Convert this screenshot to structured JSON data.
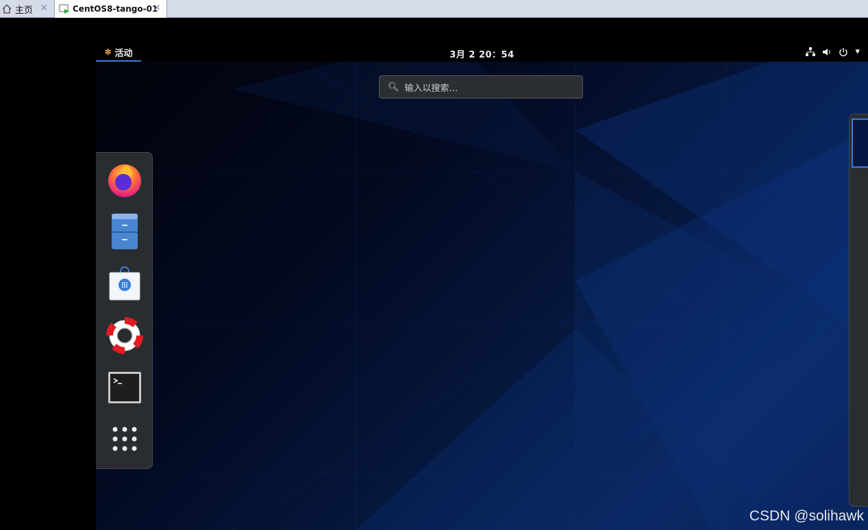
{
  "tabs": [
    {
      "label": "主页",
      "icon": "home-icon"
    },
    {
      "label": "CentOS8-tango-01",
      "icon": "vm-icon"
    }
  ],
  "topbar": {
    "activities_label": "活动",
    "clock": "3月 2  20：54",
    "tray_icons": [
      "network-icon",
      "volume-icon",
      "power-icon",
      "dropdown-icon"
    ]
  },
  "search": {
    "placeholder": "输入以搜索…"
  },
  "dash": {
    "apps": [
      "firefox-icon",
      "files-icon",
      "software-icon",
      "help-icon",
      "terminal-icon",
      "show-apps-icon"
    ]
  },
  "watermark": "CSDN @solihawk"
}
